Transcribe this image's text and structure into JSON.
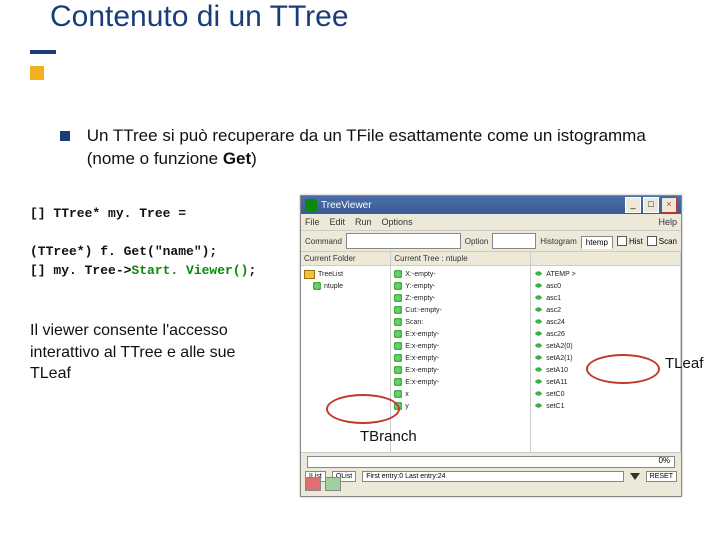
{
  "title": "Contenuto di un TTree",
  "bullet": {
    "text_1": "Un TTree si può recuperare da un TFile esattamente come un istogramma (nome o funzione ",
    "get": "Get",
    "text_2": ")"
  },
  "code": {
    "l1": "[] TTree* my. Tree =",
    "l2": "   (TTree*) f. Get(\"name\");",
    "l3a": "[] my. Tree->",
    "l3b": "Start. Viewer()",
    "l3c": ";"
  },
  "viewer_note": {
    "p1": "Il viewer consente l'accesso interattivo al TTree e alle sue TLeaf"
  },
  "tree_viewer": {
    "title": "TreeViewer",
    "menu": [
      "File",
      "Edit",
      "Run",
      "Options"
    ],
    "menu_right": "Help",
    "toolbar": {
      "command_lbl": "Command",
      "option_lbl": "Option",
      "histogram_lbl": "Histogram",
      "hist_val": "htemp",
      "hist_chk": "Hist",
      "scan_chk": "Scan"
    },
    "col1_head": "Current Folder",
    "col1_items": [
      "TreeList",
      "   ntuple"
    ],
    "col2_head": "Current Tree : ntuple",
    "col2_items": [
      "X:-empty-",
      "Y:-empty-",
      "Z:-empty-",
      "Cut:-empty-",
      "Scan:",
      "E:x-empty-",
      "E:x-empty-",
      "E:x-empty-",
      "E:x-empty-",
      "E:x-empty-",
      "x",
      "y"
    ],
    "col3_items": [
      "ATEMP >",
      "asc0",
      "asc1",
      "asc2",
      "asc24",
      "asc26",
      "setA2(0)",
      "setA2(1)",
      "setA10",
      "setA11",
      "setC0",
      "setC1"
    ],
    "progress": "0%",
    "status": {
      "ilist": "IList",
      "olist": "OList",
      "first": "First entry:0  Last entry:24",
      "reset": "RESET"
    }
  },
  "annotations": {
    "branch": "TBranch",
    "leaf": "TLeaf"
  }
}
